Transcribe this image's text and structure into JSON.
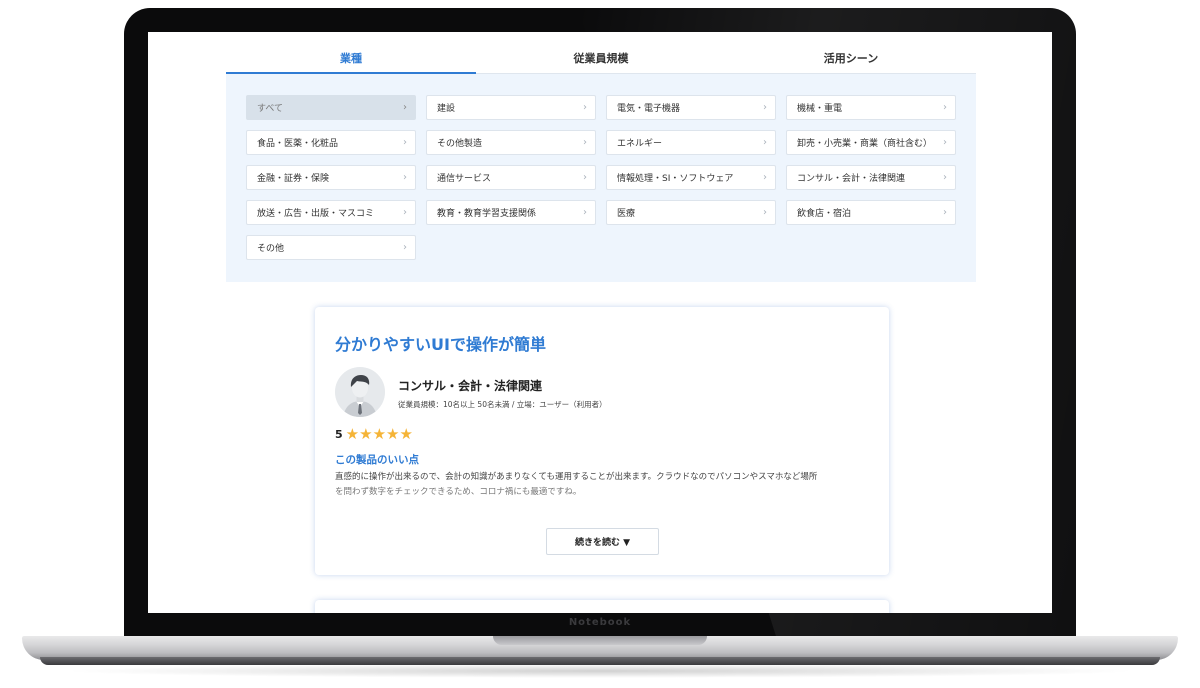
{
  "device": {
    "brand": "Notebook"
  },
  "tabs": [
    {
      "label": "業種",
      "active": true
    },
    {
      "label": "従業員規模",
      "active": false
    },
    {
      "label": "活用シーン",
      "active": false
    }
  ],
  "categories": [
    {
      "label": "すべて",
      "selected": true
    },
    {
      "label": "建設"
    },
    {
      "label": "電気・電子機器"
    },
    {
      "label": "機械・重電"
    },
    {
      "label": "食品・医薬・化粧品"
    },
    {
      "label": "その他製造"
    },
    {
      "label": "エネルギー"
    },
    {
      "label": "卸売・小売業・商業（商社含む）"
    },
    {
      "label": "金融・証券・保険"
    },
    {
      "label": "通信サービス"
    },
    {
      "label": "情報処理・SI・ソフトウェア"
    },
    {
      "label": "コンサル・会計・法律関連"
    },
    {
      "label": "放送・広告・出版・マスコミ"
    },
    {
      "label": "教育・教育学習支援関係"
    },
    {
      "label": "医療"
    },
    {
      "label": "飲食店・宿泊"
    },
    {
      "label": "その他"
    }
  ],
  "review": {
    "title": "分かりやすいUIで操作が簡単",
    "reviewer_category": "コンサル・会計・法律関連",
    "reviewer_meta": "従業員規模：10名以上 50名未満 / 立場：ユーザー（利用者）",
    "rating": "5",
    "stars": 5,
    "good_points_heading": "この製品のいい点",
    "body_line1": "直感的に操作が出来るので、会計の知識があまりなくても運用することが出来ます。クラウドなのでパソコンやスマホなど場所",
    "body_line2": "を問わず数字をチェックできるため、コロナ禍にも最適ですね。",
    "more_label": "続きを読む ▼"
  },
  "colors": {
    "accent": "#2f7bd3",
    "star": "#f5b437",
    "panel_bg": "#eef5fd"
  }
}
